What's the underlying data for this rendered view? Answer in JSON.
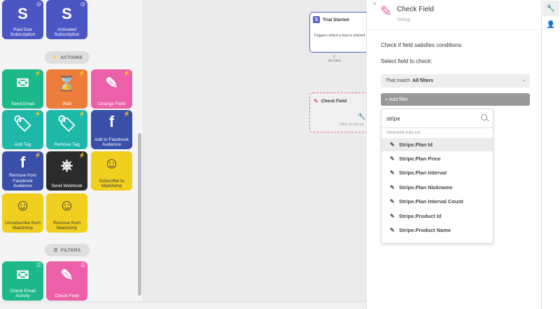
{
  "palette": {
    "triggers": [
      {
        "label": "Past Due Subscription",
        "glyph": "S",
        "icon": "stripe-icon"
      },
      {
        "label": "Activated Subscription",
        "glyph": "S",
        "icon": "stripe-icon"
      }
    ],
    "actions_label": "ACTIONS",
    "actions": [
      {
        "label": "Send Email",
        "glyph": "✉",
        "icon": "envelope-icon"
      },
      {
        "label": "Wait",
        "glyph": "⌛",
        "icon": "hourglass-icon"
      },
      {
        "label": "Change Field",
        "glyph": "✎",
        "icon": "pencil-icon"
      },
      {
        "label": "Add Tag",
        "glyph": "🏷",
        "icon": "tag-icon"
      },
      {
        "label": "Remove Tag",
        "glyph": "🏷",
        "icon": "tag-icon"
      },
      {
        "label": "Add to Facebook Audience",
        "glyph": "f",
        "icon": "facebook-icon"
      },
      {
        "label": "Remove from Facebook Audience",
        "glyph": "f",
        "icon": "facebook-icon"
      },
      {
        "label": "Send Webhook",
        "glyph": "⎈",
        "icon": "webhook-icon"
      },
      {
        "label": "Subscribe to Mailchimp",
        "glyph": "☺",
        "icon": "mailchimp-icon"
      },
      {
        "label": "Unsubscribe from Mailchimp",
        "glyph": "☺",
        "icon": "mailchimp-icon"
      },
      {
        "label": "Remove from Mailchimp",
        "glyph": "☺",
        "icon": "mailchimp-icon"
      }
    ],
    "filters_label": "FILTERS",
    "filters": [
      {
        "label": "Check Email Activity",
        "glyph": "✉",
        "icon": "envelope-icon"
      },
      {
        "label": "Check Field",
        "glyph": "✎",
        "icon": "pencil-icon"
      }
    ]
  },
  "canvas": {
    "trial_node": {
      "title": "Trial Started",
      "description": "Triggers when a trial is started",
      "count": "0",
      "count_caption": "are here"
    },
    "check_node": {
      "title": "Check Field",
      "hint": "Click to set up"
    }
  },
  "panel": {
    "close": "×",
    "title": "Check Field",
    "subtitle": "Setup",
    "description": "Check if field satisfies conditions",
    "select_prompt": "Select field to check:",
    "match_prefix": "That match",
    "match_value": "All filters",
    "add_filter": "+ Add filter",
    "dropdown": {
      "search_value": "stripe",
      "group_label": "PERSON FIELDS",
      "items": [
        "Stripe.Plan Id",
        "Stripe.Plan Price",
        "Stripe.Plan Interval",
        "Stripe.Plan Nickname",
        "Stripe.Plan Interval Count",
        "Stripe.Product Id",
        "Stripe.Product Name"
      ],
      "active_index": 0
    }
  },
  "rail": {
    "buttons": [
      {
        "icon": "wrench-icon",
        "glyph": "🔧"
      },
      {
        "icon": "person-icon",
        "glyph": "👤"
      }
    ]
  },
  "colors": {
    "stripe": "#4b55c4",
    "email": "#1db88a",
    "wait": "#ec7d3a",
    "change_field": "#ec5fa9",
    "tag": "#1eb8a9",
    "facebook": "#3a4fa8",
    "webhook": "#2b2b2b",
    "mailchimp": "#f1cf1f"
  }
}
